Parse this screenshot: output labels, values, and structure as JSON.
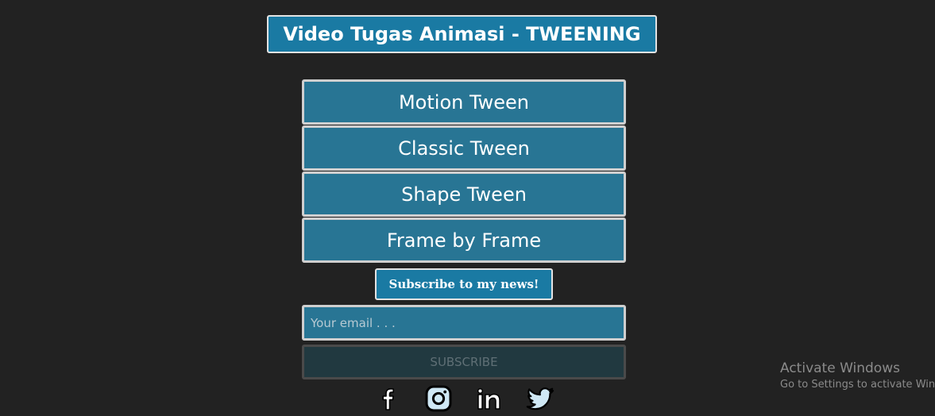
{
  "header": {
    "title": "Video Tugas Animasi - TWEENING"
  },
  "menu": {
    "items": [
      {
        "label": "Motion Tween"
      },
      {
        "label": "Classic Tween"
      },
      {
        "label": "Shape Tween"
      },
      {
        "label": "Frame by Frame"
      }
    ]
  },
  "newsletter": {
    "heading": "Subscribe to my news!",
    "email_placeholder": "Your email . . .",
    "subscribe_label": "SUBSCRIBE"
  },
  "social": {
    "icons": [
      "facebook-icon",
      "instagram-icon",
      "linkedin-icon",
      "twitter-icon"
    ]
  },
  "watermark": {
    "title": "Activate Windows",
    "subtitle": "Go to Settings to activate Windows."
  },
  "colors": {
    "background": "#222222",
    "accent": "#1a7aa3",
    "button": "#287594"
  }
}
